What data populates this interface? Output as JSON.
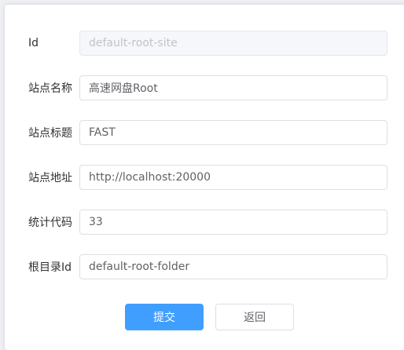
{
  "form": {
    "fields": [
      {
        "label": "Id",
        "value": "default-root-site",
        "disabled": true
      },
      {
        "label": "站点名称",
        "value": "高速网盘Root",
        "disabled": false
      },
      {
        "label": "站点标题",
        "value": "FAST",
        "disabled": false
      },
      {
        "label": "站点地址",
        "value": "http://localhost:20000",
        "disabled": false
      },
      {
        "label": "统计代码",
        "value": "33",
        "disabled": false
      },
      {
        "label": "根目录Id",
        "value": "default-root-folder",
        "disabled": false
      }
    ],
    "submit_label": "提交",
    "back_label": "返回"
  },
  "colors": {
    "primary": "#409eff",
    "border": "#dcdfe6",
    "disabled_bg": "#f5f7fa",
    "disabled_text": "#c0c4cc"
  }
}
